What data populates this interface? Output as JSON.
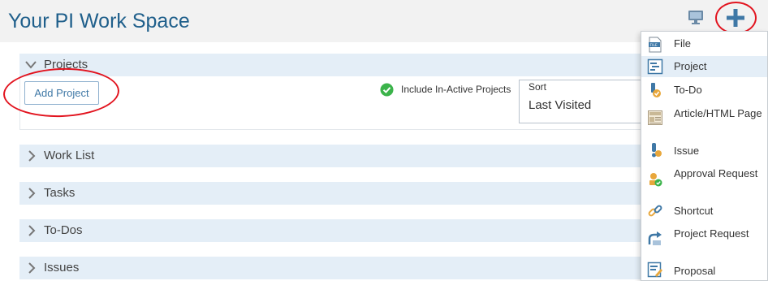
{
  "header": {
    "title": "Your PI Work Space",
    "monitor_icon": "monitor-icon",
    "add_icon": "plus-icon"
  },
  "projects": {
    "section_label": "Projects",
    "add_button_label": "Add Project",
    "include_inactive_label": "Include In-Active Projects",
    "include_inactive_checked": true,
    "sort_label": "Sort",
    "sort_value": "Last Visited"
  },
  "sections": [
    {
      "label": "Work List"
    },
    {
      "label": "Tasks"
    },
    {
      "label": "To-Dos"
    },
    {
      "label": "Issues"
    }
  ],
  "add_menu": {
    "items": [
      {
        "label": "File",
        "icon": "file-icon"
      },
      {
        "label": "Project",
        "icon": "project-icon",
        "selected": true
      },
      {
        "label": "To-Do",
        "icon": "todo-icon"
      },
      {
        "label": "Article/HTML Page",
        "icon": "article-icon"
      },
      {
        "label": "Issue",
        "icon": "issue-icon"
      },
      {
        "label": "Approval Request",
        "icon": "approval-icon"
      },
      {
        "label": "Shortcut",
        "icon": "shortcut-icon"
      },
      {
        "label": "Project Request",
        "icon": "project-request-icon"
      },
      {
        "label": "Proposal",
        "icon": "proposal-icon"
      }
    ]
  },
  "colors": {
    "title": "#1f5f8b",
    "section_header_bg": "#e4eef7",
    "accent_blue": "#3f78a6",
    "annotation_red": "#e2141f",
    "check_green": "#3bb34a"
  }
}
